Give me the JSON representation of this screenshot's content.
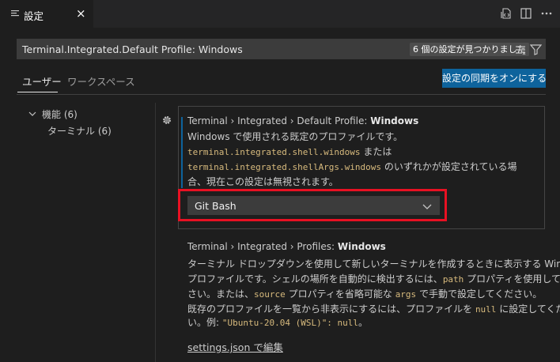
{
  "tab": {
    "title": "設定",
    "close": "×"
  },
  "search": {
    "value": "Terminal.Integrated.Default Profile: Windows",
    "result_badge": "6 個の設定が見つかりました"
  },
  "scope_tabs": {
    "user": "ユーザー",
    "workspace": "ワークスペース"
  },
  "sync_button": "設定の同期をオンにする",
  "toc": {
    "category": "機能 (6)",
    "subcategory": "ターミナル (6)"
  },
  "setting_default_profile": {
    "title_category": "Terminal › Integrated › Default Profile: ",
    "title_name": "Windows",
    "desc_line1": "Windows で使用される既定のプロファイルです。",
    "code_shell": "terminal.integrated.shell.windows",
    "text_or": " または",
    "code_shell_args": "terminal.integrated.shellArgs.windows",
    "text_either": " のいずれかが設定されている場",
    "desc_line4": "合、現在この設定は無視されます。",
    "dropdown_value": "Git Bash"
  },
  "setting_profiles": {
    "title_category": "Terminal › Integrated › Profiles: ",
    "title_name": "Windows",
    "line1": "ターミナル ドロップダウンを使用して新しいターミナルを作成するときに表示する Windows",
    "line2_a": "プロファイルです。シェルの場所を自動的に検出するには、",
    "line2_code": "path",
    "line2_b": " プロパティを使用してくだ",
    "line3_a": "さい。または、",
    "line3_code1": "source",
    "line3_b": " プロパティを省略可能な ",
    "line3_code2": "args",
    "line3_c": " で手動で設定してください。",
    "line4_a": "既存のプロファイルを一覧から非表示にするには、プロファイルを ",
    "line4_code": "null",
    "line4_b": " に設定してくださ",
    "line5_a": "い。例: ",
    "line5_code": "\"Ubuntu-20.04 (WSL)\": null",
    "line5_b": "。",
    "edit_link": "settings.json で編集"
  },
  "colors": {
    "background": "#1e1e1e",
    "accent_button": "#0e639c",
    "highlight_box": "#e81123",
    "code_text": "#d7ba7d"
  },
  "icons": [
    "settings-file-icon",
    "close-icon",
    "open-json-icon",
    "split-editor-icon",
    "more-actions-icon",
    "clear-filter-icon",
    "filter-icon",
    "chevron-down-icon",
    "gear-icon"
  ]
}
